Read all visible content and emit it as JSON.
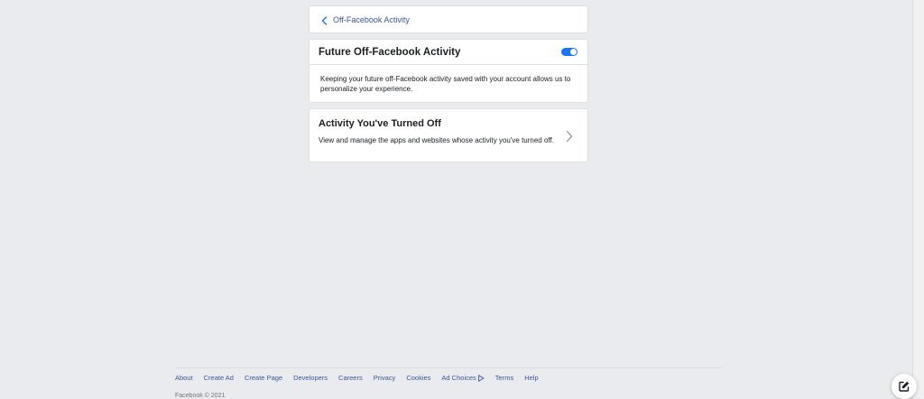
{
  "back": {
    "label": "Off-Facebook Activity"
  },
  "future": {
    "title": "Future Off-Facebook Activity",
    "toggle_on": true,
    "description": "Keeping your future off-Facebook activity saved with your account allows us to personalize your experience."
  },
  "turned_off": {
    "title": "Activity You've Turned Off",
    "description": "View and manage the apps and websites whose activity you've turned off."
  },
  "footer": {
    "links": [
      "About",
      "Create Ad",
      "Create Page",
      "Developers",
      "Careers",
      "Privacy",
      "Cookies"
    ],
    "ad_choices": "Ad Choices",
    "links_after": [
      "Terms",
      "Help"
    ],
    "copyright": "Facebook © 2021"
  },
  "colors": {
    "accent": "#1877f2",
    "link": "#385898",
    "background": "#e9ebee"
  },
  "icons": {
    "back": "chevron-left-icon",
    "toggle": "toggle-switch",
    "row_arrow": "chevron-right-icon",
    "ad_choices": "ad-choices-icon",
    "compose": "compose-icon"
  }
}
